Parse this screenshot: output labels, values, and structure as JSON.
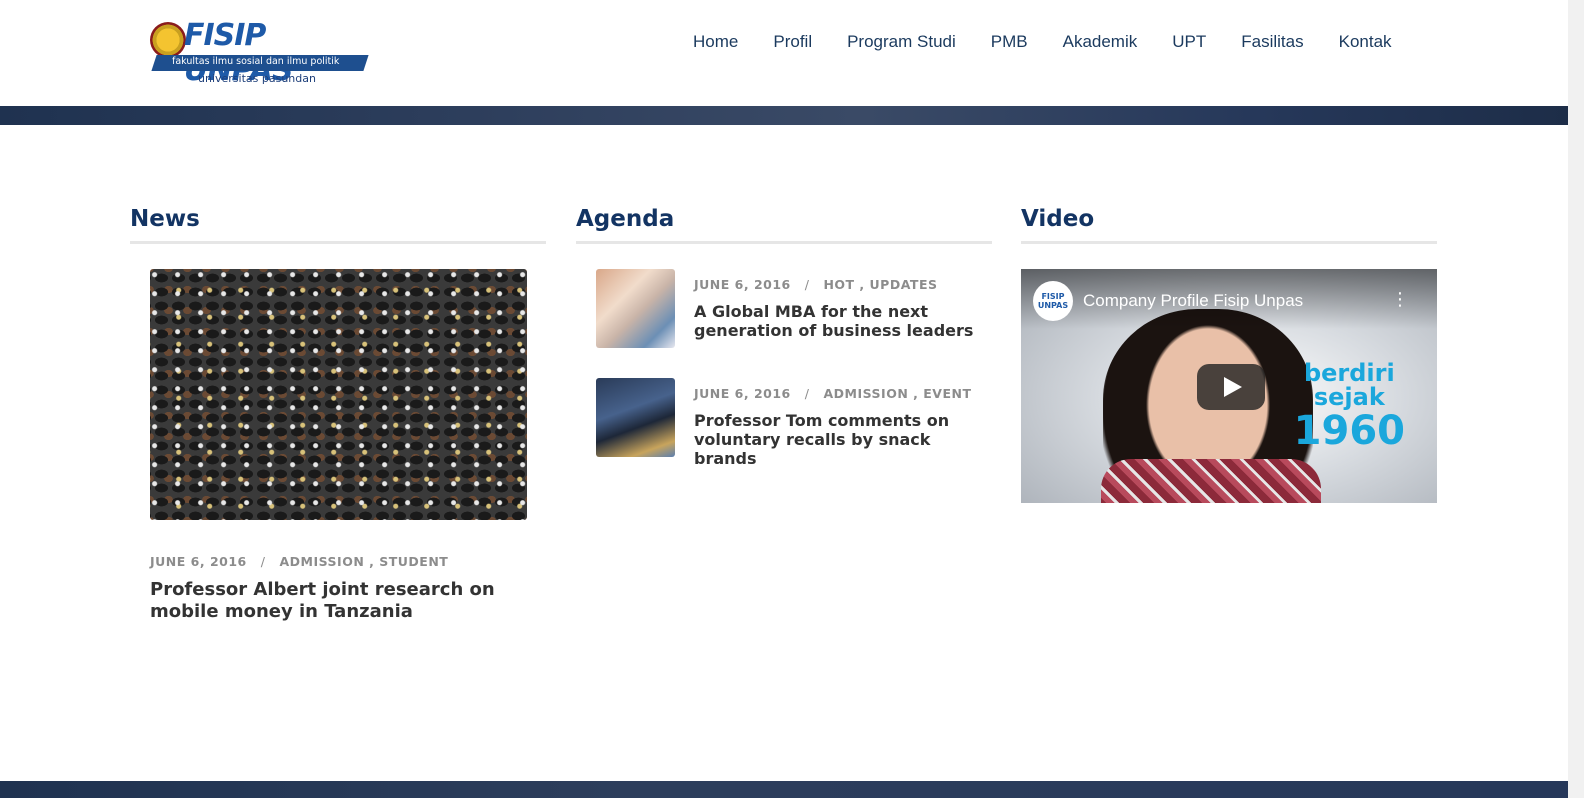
{
  "brand": {
    "logo_text": "FISIP UNPAS",
    "logo_sub1": "fakultas ilmu sosial dan ilmu politik",
    "logo_sub2": "universitas pasundan"
  },
  "nav": {
    "items": [
      "Home",
      "Profil",
      "Program Studi",
      "PMB",
      "Akademik",
      "UPT",
      "Fasilitas",
      "Kontak"
    ]
  },
  "news": {
    "heading": "News",
    "item": {
      "date": "JUNE 6, 2016",
      "separator": "/",
      "categories": "ADMISSION , STUDENT",
      "title": "Professor Albert joint research on mobile money in Tanzania"
    }
  },
  "agenda": {
    "heading": "Agenda",
    "items": [
      {
        "date": "JUNE 6, 2016",
        "separator": "/",
        "categories": "HOT , UPDATES",
        "title": "A Global MBA for the next generation of business leaders"
      },
      {
        "date": "JUNE 6, 2016",
        "separator": "/",
        "categories": "ADMISSION , EVENT",
        "title": "Professor Tom comments on voluntary recalls by snack brands"
      }
    ]
  },
  "video": {
    "heading": "Video",
    "title": "Company Profile Fisip Unpas",
    "channel_avatar": "FISIP UNPAS",
    "menu_icon": "⋮",
    "overlay_line1": "berdiri",
    "overlay_line2": "sejak",
    "overlay_year": "1960"
  },
  "colors": {
    "heading": "#133463",
    "nav": "#1b3a5e",
    "meta": "#8c8c8c",
    "strip": "#2d3e5c"
  }
}
